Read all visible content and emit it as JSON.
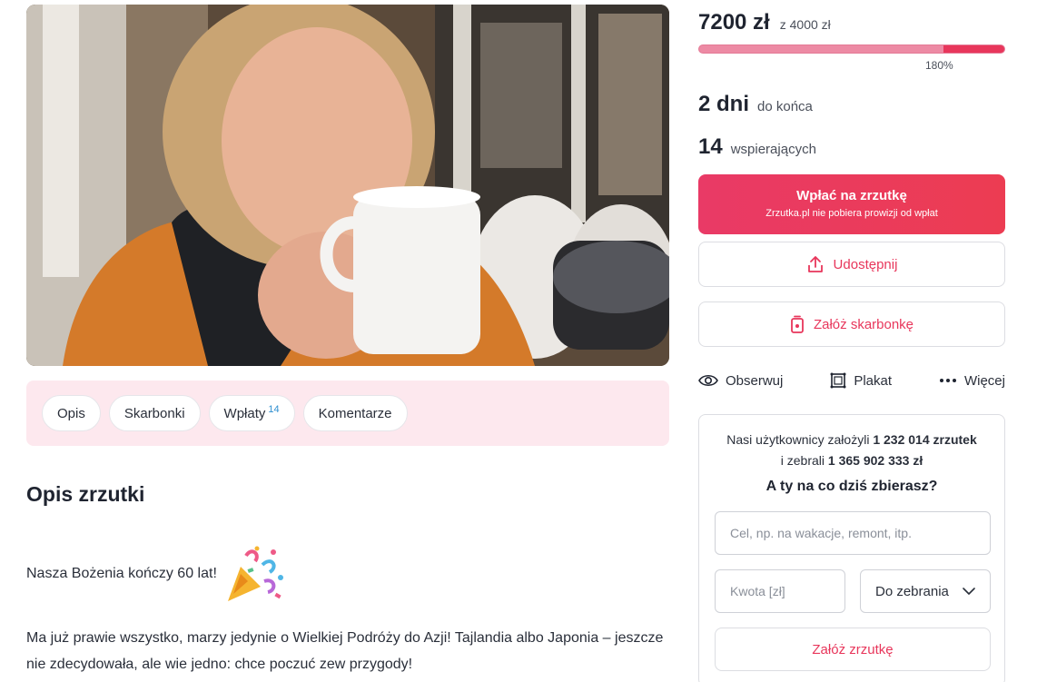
{
  "campaign": {
    "amount_raised": "7200 zł",
    "goal_text": "z 4000 zł",
    "progress_percent_label": "180%",
    "progress_fraction": 0.8,
    "days_left_value": "2 dni",
    "days_left_label": "do końca",
    "supporters_value": "14",
    "supporters_label": "wspierających"
  },
  "donate": {
    "label": "Wpłać na zrzutkę",
    "sublabel": "Zrzutka.pl nie pobiera prowizji od wpłat"
  },
  "share": {
    "label": "Udostępnij"
  },
  "piggybank": {
    "label": "Załóż skarbonkę"
  },
  "actions": [
    {
      "label": "Obserwuj",
      "icon": "eye-icon"
    },
    {
      "label": "Plakat",
      "icon": "poster-icon"
    },
    {
      "label": "Więcej",
      "icon": "more-dots-icon"
    }
  ],
  "tabs": [
    {
      "label": "Opis",
      "badge": ""
    },
    {
      "label": "Skarbonki",
      "badge": ""
    },
    {
      "label": "Wpłaty",
      "badge": "14"
    },
    {
      "label": "Komentarze",
      "badge": ""
    }
  ],
  "description": {
    "title": "Opis zrzutki",
    "line1": "Nasza Bożenia kończy 60 lat!",
    "line1_icon": "party-popper-icon",
    "paragraph": "Ma już prawie wszystko, marzy jedynie o Wielkiej Podróży do Azji! Tajlandia albo Japonia – jeszcze nie zdecydowała, ale wie jedno: chce poczuć zew przygody!"
  },
  "create_card": {
    "stats_prefix": "Nasi użytkownicy założyli",
    "stats_count": "1 232 014 zrzutek",
    "stats_middle": "i zebrali",
    "stats_total": "1 365 902 333 zł",
    "question": "A ty na co dziś zbierasz?",
    "goal_placeholder": "Cel, np. na wakacje, remont, itp.",
    "amount_placeholder": "Kwota [zł]",
    "type_select_value": "Do zebrania",
    "submit_label": "Załóż zrzutkę"
  },
  "colors": {
    "accent": "#e8365b",
    "progress_track": "#ed8aa4",
    "tabs_bg": "#fde8ee"
  }
}
